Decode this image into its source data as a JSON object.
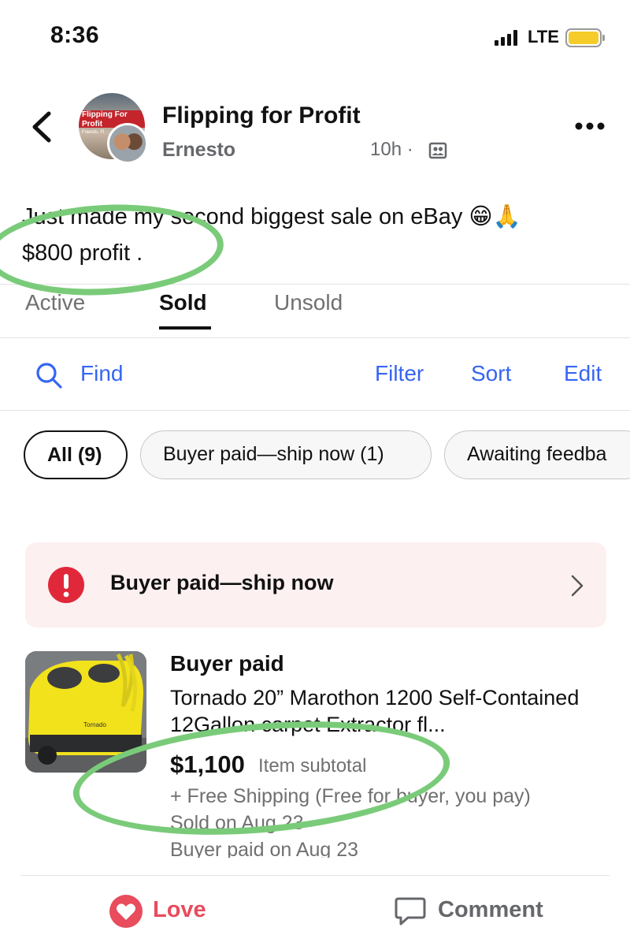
{
  "status_bar": {
    "time": "8:36",
    "network": "LTE",
    "battery_color": "#f5cc2a"
  },
  "post": {
    "group_name": "Flipping for Profit",
    "author": "Ernesto",
    "time_ago": "10h ·",
    "avatar_banner": "Flipping For Profit",
    "avatar_banner_sub": "Friends. Fl",
    "text_line_1": "Just made my second biggest sale on eBay 😁🙏",
    "text_line_2": "$800 profit ."
  },
  "ebay": {
    "tabs": [
      {
        "label": "Active"
      },
      {
        "label": "Sold"
      },
      {
        "label": "Unsold"
      }
    ],
    "active_tab": "Sold",
    "toolbar": {
      "find_label": "Find",
      "filter_label": "Filter",
      "sort_label": "Sort",
      "edit_label": "Edit"
    },
    "chips": [
      {
        "label": "All (9)"
      },
      {
        "label": "Buyer paid—ship now (1)"
      },
      {
        "label": "Awaiting feedba"
      }
    ],
    "alert": {
      "text": "Buyer paid—ship now"
    },
    "item": {
      "status": "Buyer paid",
      "title": "Tornado 20” Marothon 1200 Self-Contained 12Gallon carpet Extractor fl...",
      "price": "$1,100",
      "price_label": "Item subtotal",
      "shipping": "+ Free Shipping (Free for buyer, you pay)",
      "sold_on": "Sold on Aug 23",
      "paid_on": "Buyer paid on Aug 23"
    }
  },
  "actions": {
    "love_label": "Love",
    "comment_label": "Comment"
  },
  "colors": {
    "ebay_link": "#3665f3",
    "highlight": "#7acb79",
    "alert_red": "#e0283a",
    "love": "#e84c5d"
  },
  "icons": [
    "back-chevron-icon",
    "more-icon",
    "privacy-icon",
    "search-icon",
    "alert-exclamation-icon",
    "chevron-right-icon",
    "love-icon",
    "comment-icon",
    "signal-icon",
    "battery-icon"
  ]
}
